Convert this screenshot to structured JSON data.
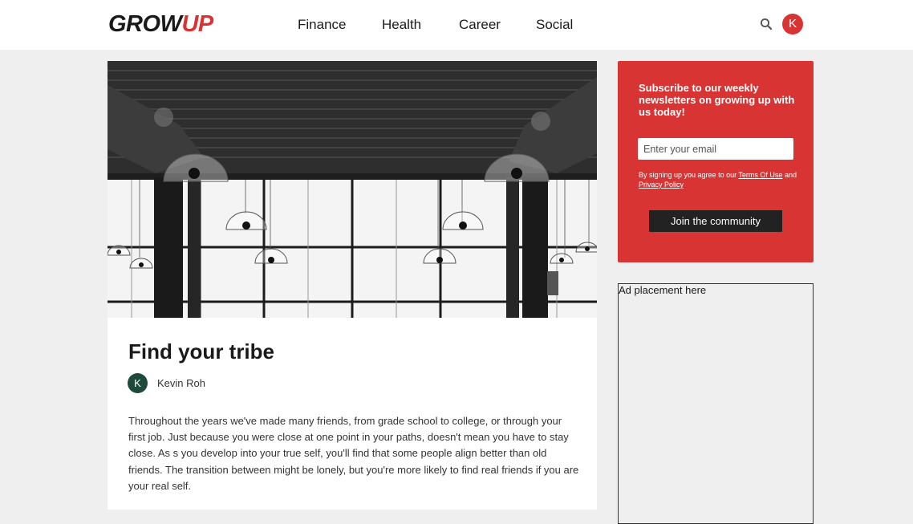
{
  "header": {
    "logo_part1": "GROW",
    "logo_part2": "UP",
    "nav": [
      "Finance",
      "Health",
      "Career",
      "Social"
    ],
    "search_icon": "search-icon",
    "user_initial": "K"
  },
  "hero": {
    "image": "black-and-white interior with pendant lamps"
  },
  "article": {
    "title": "Find your tribe",
    "author_initial": "K",
    "author_name": "Kevin Roh",
    "body": "Throughout the years we've made many friends, from grade school to college, or through your first job. Just because you were close at one point in your paths, doesn't mean you have to stay close. As s you develop into your true self, you'll find that some people align better than old friends. The transition between might be lonely, but you're more likely to find real friends if you are your real self."
  },
  "newsletter": {
    "heading": "Subscribe to our weekly newsletters on growing up with us today!",
    "email_placeholder": "Enter your email",
    "terms_prefix": "By signing up you agree to our ",
    "terms_link": "Terms Of Use",
    "terms_and": " and ",
    "privacy_link": "Privacy Policy",
    "button_label": "Join the community"
  },
  "ad": {
    "label": "Ad placement here"
  },
  "colors": {
    "accent": "#d93434",
    "author_avatar": "#1d4a3a",
    "button": "#222222"
  }
}
